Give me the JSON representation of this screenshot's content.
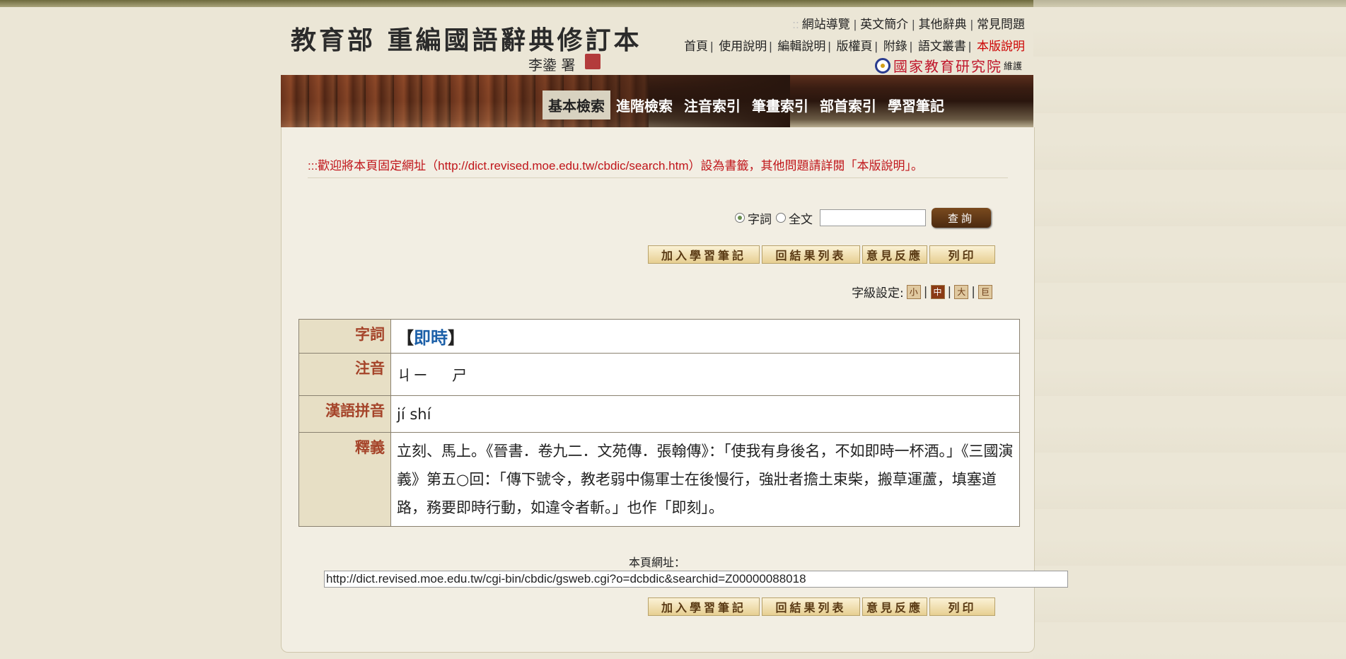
{
  "header": {
    "logo_title": "教育部 重編國語辭典修訂本",
    "logo_sub": "李鍌 署",
    "top_links": [
      "網站導覽",
      "英文簡介",
      "其他辭典",
      "常見問題"
    ],
    "sub_links": [
      "首頁",
      "使用說明",
      "編輯說明",
      "版權頁",
      "附錄",
      "語文叢書",
      "本版說明"
    ],
    "maintainer_name": "國家教育研究院",
    "maintainer_suffix": "維護"
  },
  "nav": {
    "items": [
      "基本檢索",
      "進階檢索",
      "注音索引",
      "筆畫索引",
      "部首索引",
      "學習筆記"
    ],
    "active_index": 0
  },
  "notice": ":::歡迎將本頁固定網址（http://dict.revised.moe.edu.tw/cbdic/search.htm）設為書籤，其他問題請詳閱「本版說明」。",
  "search": {
    "options": [
      "字詞",
      "全文"
    ],
    "selected": "字詞",
    "input_value": "",
    "button_label": "查詢"
  },
  "toolbar": {
    "buttons": [
      "加入學習筆記",
      "回結果列表",
      "意見反應",
      "列印"
    ]
  },
  "font_size": {
    "label": "字級設定:",
    "options": [
      "小",
      "中",
      "大",
      "巨"
    ],
    "selected": "中"
  },
  "entry": {
    "labels": {
      "word": "字詞",
      "zhuyin": "注音",
      "pinyin": "漢語拼音",
      "definition": "釋義"
    },
    "word_open": "【",
    "word": "即時",
    "word_close": "】",
    "zhuyin": [
      "ㄐㄧ",
      "ㄕ"
    ],
    "pinyin": "jí shí",
    "definition": "立刻、馬上。《晉書．卷九二．文苑傳．張翰傳》：「使我有身後名，不如即時一杯酒。」《三國演義》第五○回：「傳下號令，教老弱中傷軍士在後慢行，強壯者擔土束柴，搬草運蘆，填塞道路，務要即時行動，如違令者斬。」也作「即刻」。"
  },
  "page_url": {
    "label": "本頁網址：",
    "value": "http://dict.revised.moe.edu.tw/cgi-bin/cbdic/gsweb.cgi?o=dcbdic&searchid=Z00000088018"
  },
  "colors": {
    "accent_red": "#c0151a",
    "label_brown": "#a5442a",
    "word_blue": "#1b5fa8",
    "page_bg": "#ebe6d6"
  }
}
